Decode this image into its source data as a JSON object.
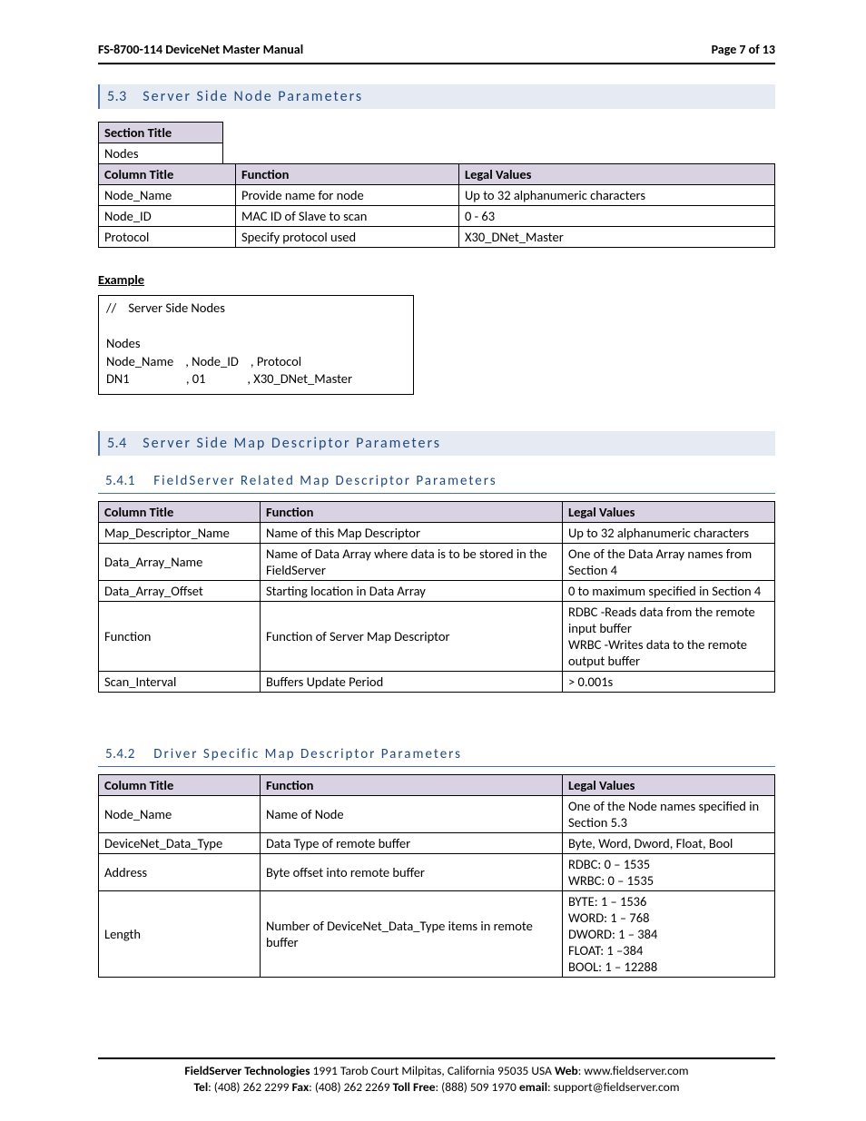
{
  "header": {
    "title": "FS-8700-114 DeviceNet Master Manual",
    "page": "Page 7 of 13"
  },
  "s53": {
    "num": "5.3",
    "title": "Server Side Node Parameters",
    "section_title_label": "Section Title",
    "section_title_value": "Nodes",
    "columns": [
      "Column Title",
      "Function",
      "Legal Values"
    ],
    "rows": [
      [
        "Node_Name",
        "Provide name for node",
        "Up to 32 alphanumeric characters"
      ],
      [
        "Node_ID",
        "MAC ID of Slave to scan",
        "0 - 63"
      ],
      [
        "Protocol",
        "Specify protocol used",
        "X30_DNet_Master"
      ]
    ],
    "example_label": "Example",
    "example": {
      "l1": "//    Server Side Nodes",
      "l2": "",
      "l3": "Nodes",
      "l4": "Node_Name    , Node_ID    , Protocol",
      "l5": "DN1                   , 01              , X30_DNet_Master"
    }
  },
  "s54": {
    "num": "5.4",
    "title": "Server Side Map Descriptor Parameters"
  },
  "s541": {
    "num": "5.4.1",
    "title": "FieldServer Related Map Descriptor Parameters",
    "columns": [
      "Column Title",
      "Function",
      "Legal Values"
    ],
    "rows": [
      [
        "Map_Descriptor_Name",
        "Name of this Map Descriptor",
        "Up to 32 alphanumeric characters"
      ],
      [
        "Data_Array_Name",
        "Name of Data Array where data is to be stored in the FieldServer",
        "One of the Data Array names from Section 4"
      ],
      [
        "Data_Array_Offset",
        "Starting location in Data Array",
        "0 to maximum specified in Section 4"
      ],
      [
        "Function",
        "Function of Server Map Descriptor",
        "RDBC -Reads data from the remote input buffer\nWRBC -Writes data to the remote output buffer"
      ],
      [
        "Scan_Interval",
        "Buffers Update Period",
        "> 0.001s"
      ]
    ]
  },
  "s542": {
    "num": "5.4.2",
    "title": "Driver Specific Map Descriptor Parameters",
    "columns": [
      "Column Title",
      "Function",
      "Legal Values"
    ],
    "rows": [
      [
        "Node_Name",
        "Name of Node",
        "One of the Node names specified in Section 5.3"
      ],
      [
        "DeviceNet_Data_Type",
        "Data Type of remote buffer",
        "Byte, Word, Dword, Float, Bool"
      ],
      [
        "Address",
        "Byte offset into remote buffer",
        "RDBC: 0 – 1535\nWRBC: 0 – 1535"
      ],
      [
        "Length",
        "Number of DeviceNet_Data_Type items in remote buffer",
        "BYTE: 1 – 1536\nWORD: 1 – 768\nDWORD: 1 – 384\nFLOAT: 1 –384\nBOOL: 1 – 12288"
      ]
    ]
  },
  "footer": {
    "l1a": "FieldServer Technologies",
    "l1b": " 1991 Tarob Court Milpitas, California 95035 USA   ",
    "l1c": "Web",
    "l1d": ": www.fieldserver.com",
    "l2a": "Tel",
    "l2b": ": (408) 262 2299   ",
    "l2c": "Fax",
    "l2d": ": (408) 262 2269   ",
    "l2e": "Toll Free",
    "l2f": ": (888) 509 1970   ",
    "l2g": "email",
    "l2h": ": support@fieldserver.com"
  }
}
